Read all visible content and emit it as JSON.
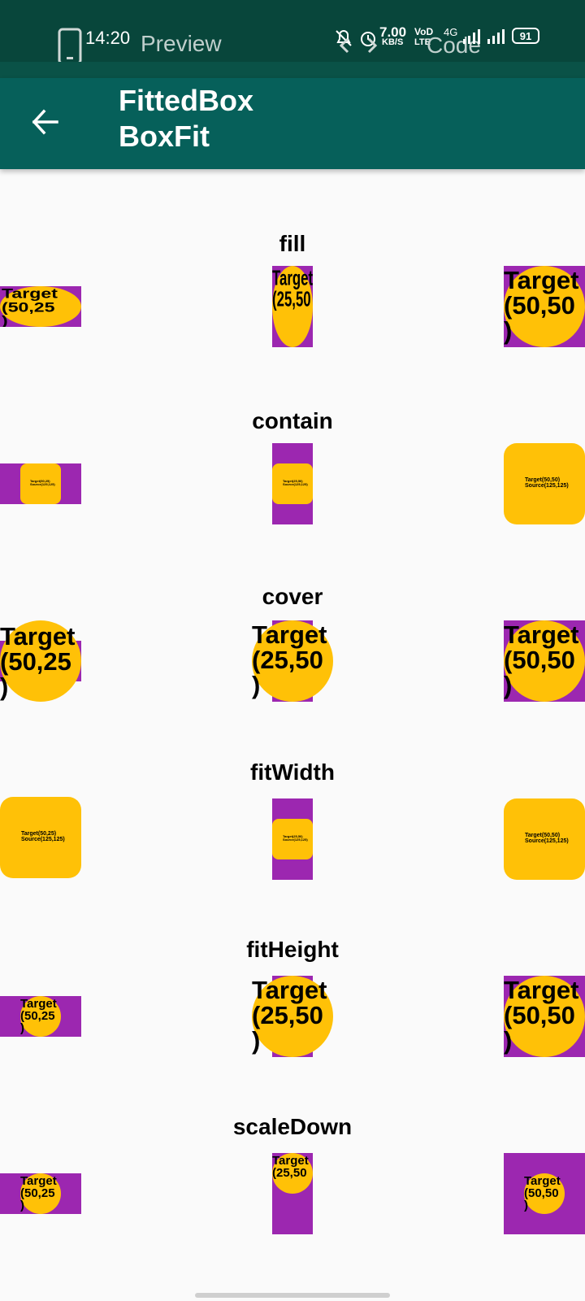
{
  "status": {
    "time": "14:20",
    "tab_preview": "Preview",
    "tab_code": "Code",
    "net_speed_value": "7.00",
    "net_speed_unit": "KB/S",
    "volte": "VoD",
    "lte": "LTE",
    "network": "4G",
    "battery": "91"
  },
  "appbar": {
    "title_line1": "FittedBox",
    "title_line2": "BoxFit"
  },
  "colors": {
    "purple": "#9c27b0",
    "amber": "#ffc107",
    "appbar": "#06605a",
    "statusbar": "#08463b"
  },
  "sections": [
    {
      "name": "fill",
      "cells": [
        {
          "target_text": "Target\n(50,25\n)"
        },
        {
          "target_text": "Target\n(25,50"
        },
        {
          "target_text": "Target\n(50,50\n)"
        }
      ]
    },
    {
      "name": "contain",
      "cells": [
        {
          "target_text": "Target(50,25)\nSource(125,125)"
        },
        {
          "target_text": "Target(25,50)\nSource(125,125)"
        },
        {
          "target_text": "Target(50,50)\nSource(125,125)"
        }
      ]
    },
    {
      "name": "cover",
      "cells": [
        {
          "target_text": "Target\n(50,25\n)"
        },
        {
          "target_text": "Target\n(25,50\n)"
        },
        {
          "target_text": "Target\n(50,50\n)"
        }
      ]
    },
    {
      "name": "fitWidth",
      "cells": [
        {
          "target_text": "Target(50,25)\nSource(125,125)"
        },
        {
          "target_text": "Target(25,50)\nSource(125,125)"
        },
        {
          "target_text": "Target(50,50)\nSource(125,125)"
        }
      ]
    },
    {
      "name": "fitHeight",
      "cells": [
        {
          "target_text": "Target\n(50,25\n)"
        },
        {
          "target_text": "Target\n(25,50\n)"
        },
        {
          "target_text": "Target\n(50,50\n)"
        }
      ]
    },
    {
      "name": "scaleDown",
      "cells": [
        {
          "target_text": "Target\n(50,25\n)"
        },
        {
          "target_text": "Target\n(25,50"
        },
        {
          "target_text": "Target\n(50,50\n)"
        }
      ]
    }
  ]
}
